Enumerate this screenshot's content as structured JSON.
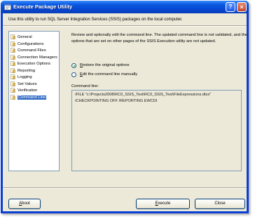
{
  "window": {
    "title": "Execute Package Utility"
  },
  "description": "Use this utility to run SQL Server Integration Services (SSIS) packages on the local computer.",
  "nav": {
    "items": [
      {
        "label": "General"
      },
      {
        "label": "Configurations"
      },
      {
        "label": "Command Files"
      },
      {
        "label": "Connection Managers"
      },
      {
        "label": "Execution Options"
      },
      {
        "label": "Reporting"
      },
      {
        "label": "Logging"
      },
      {
        "label": "Set Values"
      },
      {
        "label": "Verification"
      },
      {
        "label": "Command Line",
        "selected": true
      }
    ]
  },
  "panel": {
    "info_line1": "Review and optionally edit the command line. The updated command line is not validated, and the",
    "info_line2": "options that are set on other pages of the SSIS Execution utility are not updated.",
    "restore_label": "Restore the original options",
    "edit_label": "Edit the command line manually",
    "selected_option": "restore",
    "command_line_label": "Command line:",
    "command_line_1": "/FILE \"c:\\Projects2008\\RC0_SSIS_Test\\RC0_SSIS_Test\\FileExpressions.dtsx\"",
    "command_line_2": "/CHECKPOINTING OFF  /REPORTING EWCDI"
  },
  "buttons": {
    "about": "About",
    "execute": "Execute",
    "close": "Close"
  },
  "colors": {
    "title_bar": "#0a5ae0",
    "selection": "#316ac5",
    "dialog_bg": "#ece9d8"
  }
}
